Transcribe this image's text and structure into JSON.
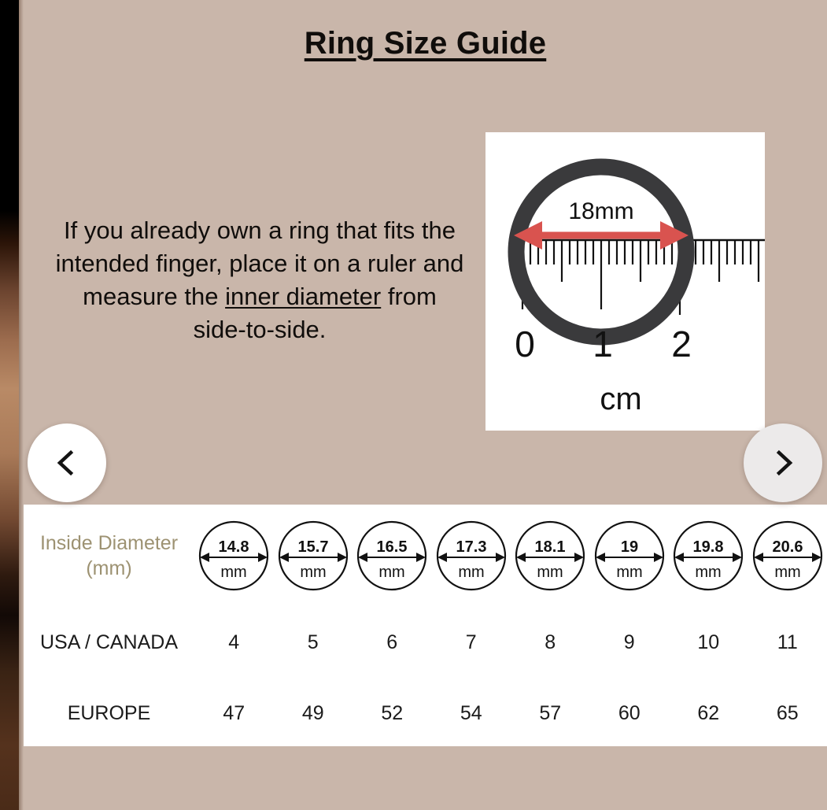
{
  "theme": {
    "background": "#c9b6aa",
    "panel": "#ffffff",
    "text": "#100d0b",
    "label_olive": "#9d9272",
    "ring_dark": "#3a3a3c",
    "arrow_red": "#d9534f"
  },
  "header": {
    "title": "Ring Size Guide"
  },
  "instruction": {
    "part1": "If you already own a ring that fits the intended finger, place it on a ruler and measure the ",
    "underlined": "inner diameter",
    "part2": " from side-to-side."
  },
  "illustration": {
    "measurement_label": "18mm",
    "unit_label": "cm",
    "ruler_ticks": [
      "0",
      "1",
      "2"
    ]
  },
  "carousel": {
    "prev_label": "‹",
    "next_label": "›"
  },
  "table": {
    "rows": [
      {
        "label_line1": "Inside Diameter",
        "label_line2": "(mm)",
        "type": "diameter",
        "values": [
          "14.8",
          "15.7",
          "16.5",
          "17.3",
          "18.1",
          "19",
          "19.8",
          "20.6"
        ],
        "unit": "mm"
      },
      {
        "label": "USA / CANADA",
        "type": "plain",
        "values": [
          "4",
          "5",
          "6",
          "7",
          "8",
          "9",
          "10",
          "11"
        ]
      },
      {
        "label": "EUROPE",
        "type": "plain",
        "values": [
          "47",
          "49",
          "52",
          "54",
          "57",
          "60",
          "62",
          "65"
        ]
      }
    ]
  }
}
